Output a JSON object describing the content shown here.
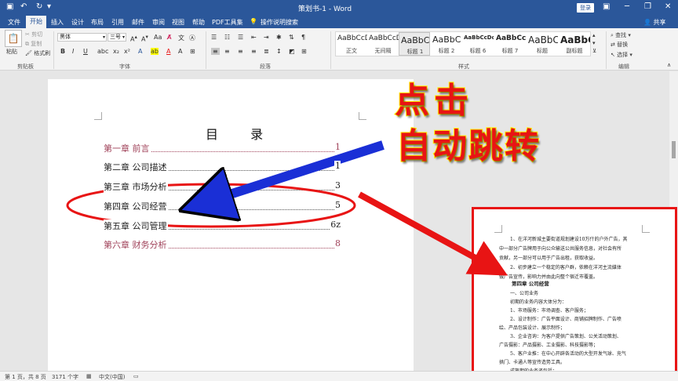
{
  "titlebar": {
    "doc_title": "策划书-1 - Word",
    "login": "登录"
  },
  "tabs": [
    "文件",
    "开始",
    "插入",
    "设计",
    "布局",
    "引用",
    "邮件",
    "审阅",
    "视图",
    "帮助",
    "PDF工具集",
    "操作说明搜索"
  ],
  "share": "共享",
  "ribbon": {
    "clipboard": {
      "paste": "粘贴",
      "cut": "剪切",
      "copy": "复制",
      "format_painter": "格式刷",
      "label": "剪贴板"
    },
    "font": {
      "name": "黑体",
      "size": "三号",
      "label": "字体",
      "format_buttons": [
        "B",
        "I",
        "U"
      ]
    },
    "paragraph": {
      "label": "段落"
    },
    "styles": {
      "label": "样式",
      "items": [
        {
          "sample": "AaBbCcDc",
          "name": "正文"
        },
        {
          "sample": "AaBbCcDc",
          "name": "无间隔"
        },
        {
          "sample": "AaBbC",
          "name": "标题 1"
        },
        {
          "sample": "AaBbC",
          "name": "标题 2"
        },
        {
          "sample": "AaBbCcDdEe",
          "name": "标题 6"
        },
        {
          "sample": "AaBbCcI",
          "name": "标题 7"
        },
        {
          "sample": "AaBbC",
          "name": "标题"
        },
        {
          "sample": "AaBbC",
          "name": "副标题"
        }
      ]
    },
    "editing": {
      "find": "查找",
      "replace": "替换",
      "select": "选择",
      "label": "编辑"
    }
  },
  "document": {
    "toc_title": "目 录",
    "toc": [
      {
        "title": "第一章  前言",
        "page": "1",
        "link": true
      },
      {
        "title": "第二章  公司描述",
        "page": "1",
        "link": false
      },
      {
        "title": "第三章  市场分析",
        "page": "3",
        "link": false
      },
      {
        "title": "第四章  公司经营",
        "page": "5",
        "link": false
      },
      {
        "title": "第五章  公司管理",
        "page": "6z",
        "link": false
      },
      {
        "title": "第六章  财务分析",
        "page": "8",
        "link": true
      }
    ]
  },
  "annotation": {
    "click": "点击",
    "jump": "自动跳转",
    "accent_red": "#e81414",
    "accent_blue": "#1a2fd6",
    "accent_yellow": "#fff200"
  },
  "preview": {
    "lines": [
      "1、在洋河新城主要街道规划建设10万什的户外广告，其",
      "中一部分广告牌用于向公众输送公共服务信息，对社会有所",
      "贡献，另一部分可以用于广告出租，获取收益。",
      "2、初步建立一个稳定的客户群，依赖在洋河主流媒体",
      "做广告宣传，影响力并由此向整个宿迁市覆盖。",
      "第四章  公司经营",
      "一、公司业务",
      "初期的业务内容大体分为：",
      "1、市场服务：市场调查、客户服务；",
      "2、设计制作：广告平面设计、商铺招牌制作、广告喷",
      "绘、产品包装设计、展示制作；",
      "3、企业咨询：为客户提供广告策划、公关活动策划、",
      "广告摄影：产品摄影、工业摄影、科技摄影等；",
      "5、客户业推：在中心开辟各活动的大型开发气球、充气",
      "拱门、卡通人等宣传造势工具。",
      "成熟期的业务还包括："
    ]
  },
  "statusbar": {
    "page": "第 1 页，共 8 页",
    "words": "3171 个字",
    "language": "中文(中国)"
  }
}
